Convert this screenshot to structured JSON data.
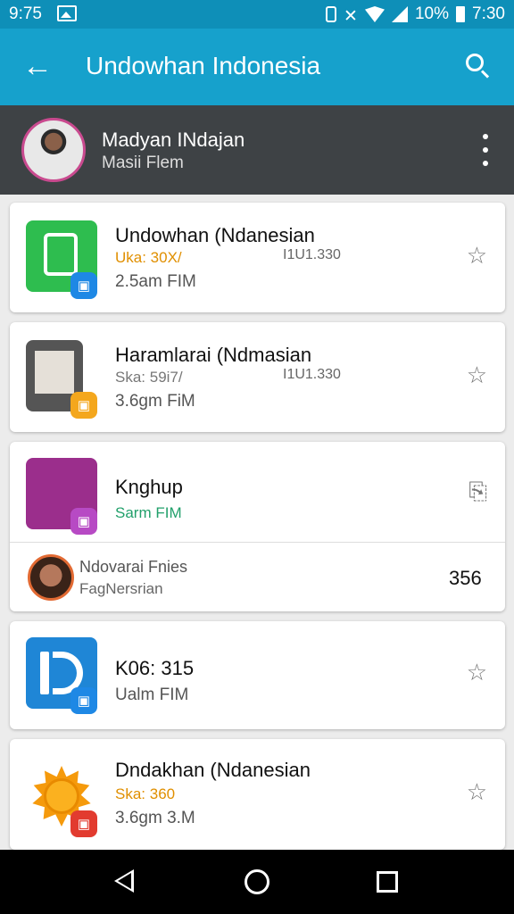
{
  "status_bar": {
    "time_left": "9:75",
    "battery": "10%",
    "time_right": "7:30"
  },
  "app_bar": {
    "back_icon": "←",
    "title": "Undowhan Indonesia",
    "search_icon": "search-icon"
  },
  "profile": {
    "name": "Madyan INdajan",
    "subtitle": "Masii Flem"
  },
  "items": [
    {
      "title": "Undowhan (Ndanesian",
      "tag": "Uka: 30X/",
      "meta": "I1U1.330",
      "size": "2.5am FIM",
      "tag_color": "#e08f00"
    },
    {
      "title": "Haramlarai (Ndmasian",
      "tag": "Ska: 59i7/",
      "meta": "I1U1.330",
      "size": "3.6gm FiM",
      "tag_color": "#777777"
    },
    {
      "title": "Knghup",
      "tag": "Sarm FIM",
      "tag_color": "#22a06b"
    },
    {
      "title": "K06: 315",
      "size": "Ualm FIM"
    },
    {
      "title": "Dndakhan (Ndanesian",
      "tag": "Ska: 360",
      "size": "3.6gm 3.M",
      "tag_color": "#e08f00"
    }
  ],
  "sub_item": {
    "title": "Ndovarai Fnies",
    "subtitle": "FagNersrian",
    "count": "356"
  }
}
